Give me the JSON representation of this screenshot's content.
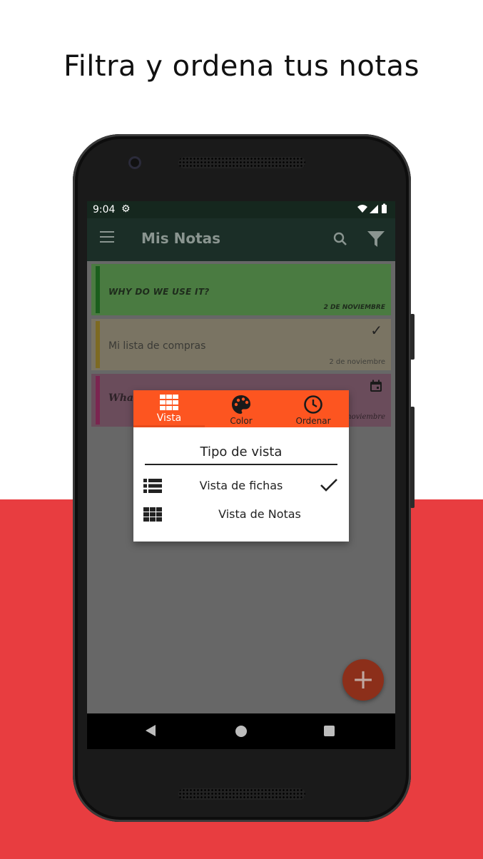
{
  "headline": "Filtra y ordena tus notas",
  "status_bar": {
    "time": "9:04"
  },
  "appbar": {
    "title": "Mis Notas"
  },
  "notes": [
    {
      "title": "WHY DO WE USE IT?",
      "date": "2 DE NOVIEMBRE",
      "color": "#4a7b41"
    },
    {
      "title": "Mi lista de compras",
      "date": "2 de noviembre",
      "color": "#7a7463"
    },
    {
      "title": "What",
      "date": "2 de noviembre",
      "color": "#6a4c5b"
    }
  ],
  "dialog": {
    "tabs": [
      {
        "label": "Vista",
        "icon": "grid-icon"
      },
      {
        "label": "Color",
        "icon": "palette-icon"
      },
      {
        "label": "Ordenar",
        "icon": "clock-icon"
      }
    ],
    "title": "Tipo de vista",
    "options": [
      {
        "label": "Vista de fichas",
        "icon": "list-icon",
        "selected": true
      },
      {
        "label": "Vista de Notas",
        "icon": "grid-icon",
        "selected": false
      }
    ]
  },
  "fab": {
    "label": "+"
  },
  "colors": {
    "accent": "#fd5520",
    "background_red": "#e83d40",
    "appbar": "#1b2e27"
  }
}
